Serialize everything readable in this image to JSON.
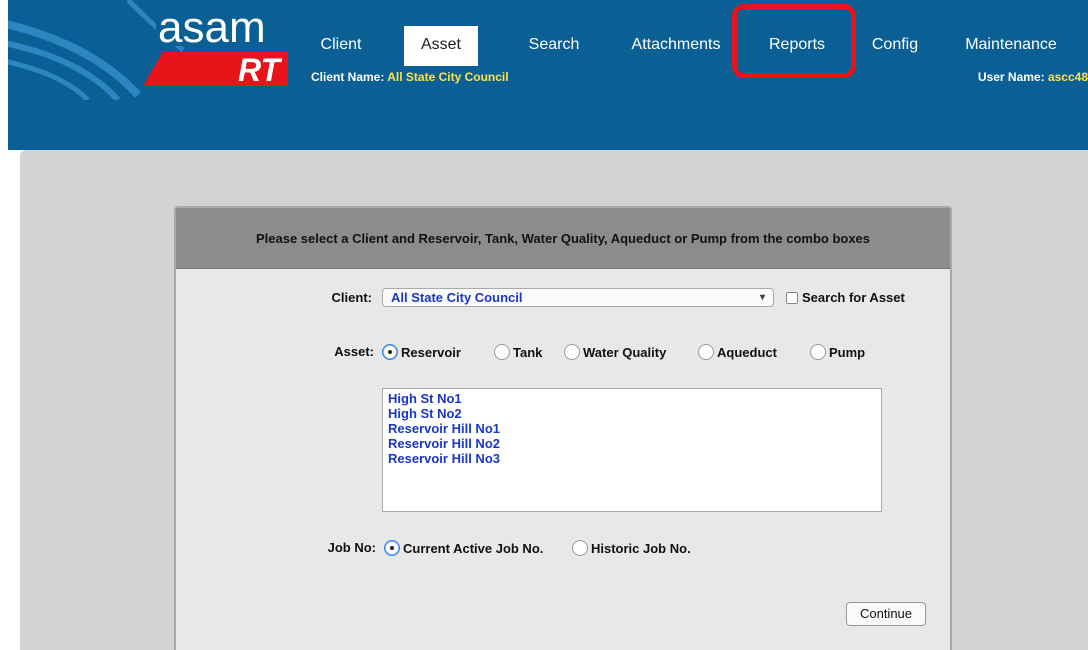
{
  "logo": {
    "top_text": "asam",
    "bottom_text": "RT"
  },
  "nav": {
    "tabs": [
      {
        "label": "Client"
      },
      {
        "label": "Asset"
      },
      {
        "label": "Search"
      },
      {
        "label": "Attachments"
      },
      {
        "label": "Reports"
      },
      {
        "label": "Config"
      },
      {
        "label": "Maintenance"
      }
    ]
  },
  "header": {
    "client_name_label": "Client Name:",
    "client_name_value": "All State City Council",
    "user_name_label": "User Name:",
    "user_name_value": "ascc48"
  },
  "panel": {
    "header_text": "Please select a Client and Reservoir, Tank, Water Quality, Aqueduct or Pump from the combo boxes",
    "client_label": "Client:",
    "client_selected": "All State City Council",
    "search_for_asset_label": "Search for Asset",
    "asset_label": "Asset:",
    "asset_options": [
      "Reservoir",
      "Tank",
      "Water Quality",
      "Aqueduct",
      "Pump"
    ],
    "asset_selected": "Reservoir",
    "assets": [
      "High St No1",
      "High St No2",
      "Reservoir Hill No1",
      "Reservoir Hill No2",
      "Reservoir Hill No3"
    ],
    "job_label": "Job No:",
    "job_options": [
      "Current Active Job No.",
      "Historic Job No."
    ],
    "job_selected": "Current Active Job No.",
    "continue_label": "Continue"
  },
  "colors": {
    "header_blue": "#0a6095",
    "highlight_red": "#e8141a",
    "client_value_yellow": "#ffe24a",
    "list_text_blue": "#1a36c8"
  }
}
